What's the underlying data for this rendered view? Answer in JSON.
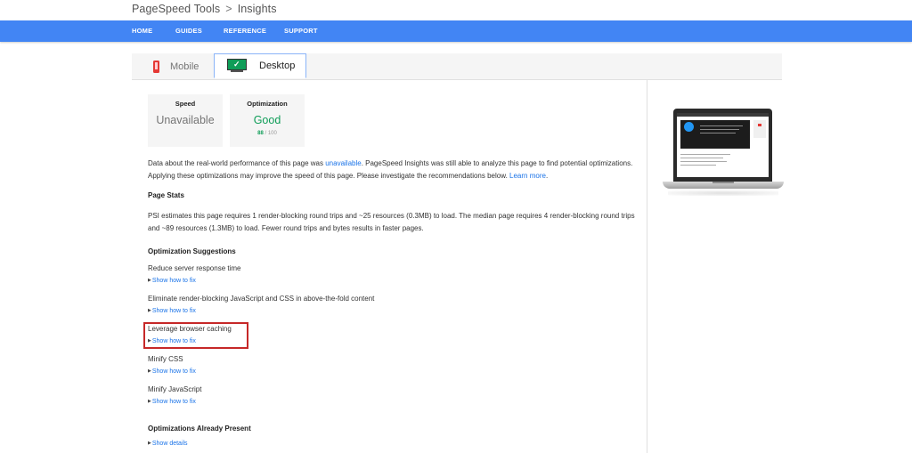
{
  "breadcrumb": {
    "root": "PageSpeed Tools",
    "separator": ">",
    "current": "Insights"
  },
  "nav": {
    "items": [
      "HOME",
      "GUIDES",
      "REFERENCE",
      "SUPPORT"
    ]
  },
  "tabs": {
    "mobile": "Mobile",
    "desktop": "Desktop"
  },
  "scores": {
    "speed": {
      "label": "Speed",
      "value": "Unavailable"
    },
    "optimization": {
      "label": "Optimization",
      "value": "Good",
      "score": "88",
      "max": "/ 100"
    }
  },
  "intro": {
    "text1": "Data about the real-world performance of this page was ",
    "link1": "unavailable",
    "text2": ". PageSpeed Insights was still able to analyze this page to find potential optimizations. Applying these optimizations may improve the speed of this page. Please investigate the recommendations below. ",
    "link2": "Learn more",
    "text3": "."
  },
  "page_stats": {
    "heading": "Page Stats",
    "text": "PSI estimates this page requires 1 render-blocking round trips and ~25 resources (0.3MB) to load. The median page requires 4 render-blocking round trips and ~89 resources (1.3MB) to load. Fewer round trips and bytes results in faster pages."
  },
  "suggestions": {
    "heading": "Optimization Suggestions",
    "items": [
      {
        "title": "Reduce server response time",
        "link": "Show how to fix"
      },
      {
        "title": "Eliminate render-blocking JavaScript and CSS in above-the-fold content",
        "link": "Show how to fix"
      },
      {
        "title": "Leverage browser caching",
        "link": "Show how to fix"
      },
      {
        "title": "Minify CSS",
        "link": "Show how to fix"
      },
      {
        "title": "Minify JavaScript",
        "link": "Show how to fix"
      }
    ]
  },
  "present": {
    "heading": "Optimizations Already Present",
    "link": "Show details"
  },
  "colors": {
    "accent": "#4285f4",
    "good": "#0f9d58",
    "link": "#1a73e8",
    "highlight": "#c62828"
  },
  "icons": {
    "mobile": "phone-icon",
    "desktop": "monitor-check-icon",
    "expand": "triangle-right-icon"
  }
}
